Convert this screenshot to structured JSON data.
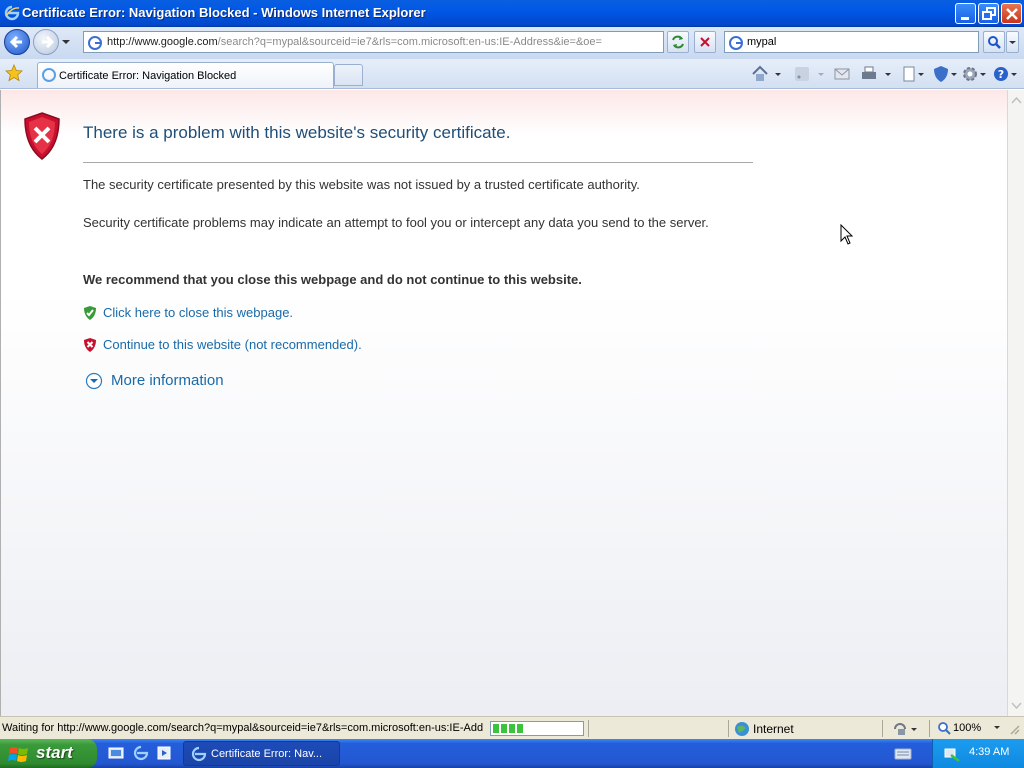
{
  "window": {
    "title": "Certificate Error: Navigation Blocked - Windows Internet Explorer"
  },
  "navbar": {
    "address_host": "http://www.google.com",
    "address_path": "/search?q=mypal&sourceid=ie7&rls=com.microsoft:en-us:IE-Address&ie=&oe=",
    "search_value": "mypal"
  },
  "tabs": [
    {
      "label": "Certificate Error: Navigation Blocked",
      "active": true
    }
  ],
  "content": {
    "heading": "There is a problem with this website's security certificate.",
    "paragraph1": "The security certificate presented by this website was not issued by a trusted certificate authority.",
    "paragraph2": "Security certificate problems may indicate an attempt to fool you or intercept any data you send to the server.",
    "recommendation": "We recommend that you close this webpage and do not continue to this website.",
    "close_link": "Click here to close this webpage.",
    "continue_link": "Continue to this website (not recommended).",
    "more_info": "More information"
  },
  "statusbar": {
    "message": "Waiting for http://www.google.com/search?q=mypal&sourceid=ie7&rls=com.microsoft:en-us:IE-Add",
    "progress_fraction": 0.35,
    "zone": "Internet",
    "zoom": "100%"
  },
  "taskbar": {
    "start_label": "start",
    "task_label": "Certificate Error: Nav...",
    "clock": "4:39 AM"
  },
  "colors": {
    "link": "#1a6aa8",
    "heading": "#1f4e79",
    "titlebar": "#0058e6",
    "error_red": "#c8102e",
    "ok_green": "#3a9a3a"
  }
}
